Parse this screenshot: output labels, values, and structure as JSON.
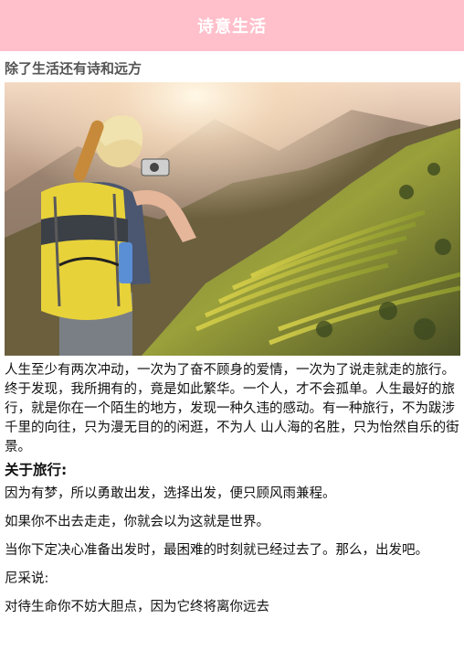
{
  "header": {
    "title": "诗意生活",
    "bg_color": "#ffc0cb"
  },
  "subtitle": "除了生活还有诗和远方",
  "hero_image": {
    "description_icon": "traveler-photo-image"
  },
  "intro_paragraph": "人生至少有两次冲动，一次为了奋不顾身的爱情，一次为了说走就走的旅行。终于发现，我所拥有的，竟是如此繁华。一个人，才不会孤单。人生最好的旅行，就是你在一个陌生的地方，发现一种久违的感动。有一种旅行，不为跋涉千里的向往，只为漫无目的的闲逛，不为人 山人海的名胜，只为怡然自乐的街景。",
  "section": {
    "heading": "关于旅行:",
    "lines": [
      "因为有梦，所以勇敢出发，选择出发，便只顾风雨兼程。",
      "如果你不出去走走，你就会以为这就是世界。",
      "当你下定决心准备出发时，最困难的时刻就已经过去了。那么，出发吧。",
      "尼采说:",
      "对待生命你不妨大胆点，因为它终将离你远去"
    ]
  }
}
